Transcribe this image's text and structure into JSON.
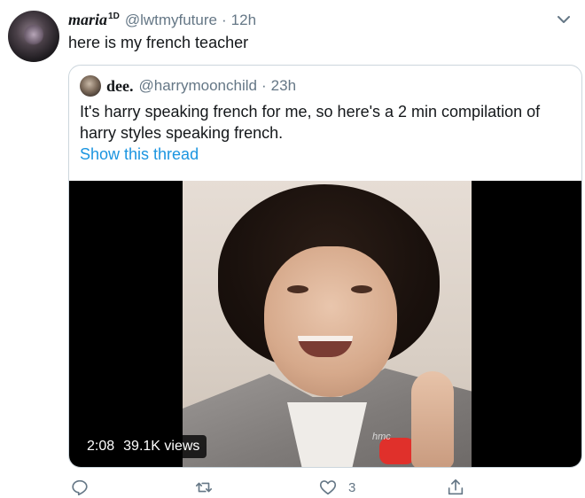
{
  "tweet": {
    "author": {
      "name": "maria",
      "name_suffix": "1D",
      "handle": "@lwtmyfuture",
      "time": "12h"
    },
    "text": "here is my french teacher",
    "quoted": {
      "author": {
        "name": "dee.",
        "handle": "@harrymoonchild",
        "time": "23h"
      },
      "text": "It's harry speaking french for me, so here's a 2 min compilation of harry styles speaking french.",
      "show_thread": "Show this thread",
      "video": {
        "duration": "2:08",
        "views": "39.1K views",
        "watermark": "hmc"
      }
    },
    "actions": {
      "reply_icon": "reply-icon",
      "retweet_icon": "retweet-icon",
      "like_icon": "heart-icon",
      "like_count": "3",
      "share_icon": "share-icon"
    }
  },
  "colors": {
    "text": "#14171a",
    "muted": "#657786",
    "link": "#1b95e0",
    "border": "#ccd6dd"
  }
}
